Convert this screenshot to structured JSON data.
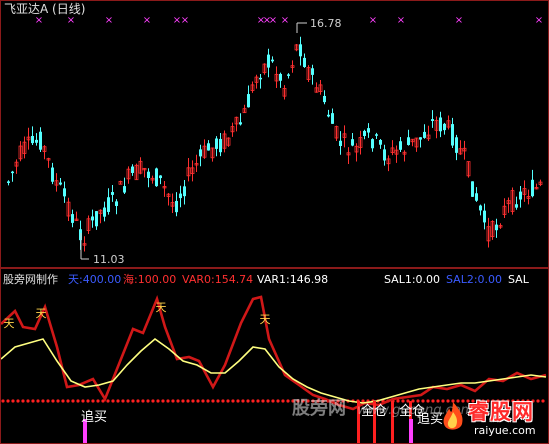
{
  "window": {
    "title": "飞亚达A (日线)"
  },
  "main_chart": {
    "high_label": "16.78",
    "low_label": "11.03"
  },
  "indicator": {
    "name": "股旁网制作",
    "values": [
      {
        "label": "天:400.00",
        "color": "#3b5bff"
      },
      {
        "label": "海:100.00",
        "color": "#ff3030"
      },
      {
        "label": "VAR0:154.74",
        "color": "#ff3030"
      },
      {
        "label": "VAR1:146.98",
        "color": "#ffffff"
      },
      {
        "label": "SAL1:0.00",
        "color": "#ffffff"
      },
      {
        "label": "SAL2:0.00",
        "color": "#3b5bff"
      },
      {
        "label": "SAL",
        "color": "#ffffff"
      }
    ],
    "signal_labels": [
      "追买",
      "全仓",
      "全仓",
      "追买"
    ],
    "star_glyph": "天"
  },
  "watermarks": {
    "site_cn": "股旁网",
    "site_en": "www.gupang.com",
    "logo_cn": "睿股网",
    "logo_en": "raiyue.com"
  },
  "colors": {
    "up": "#ff3030",
    "down": "#54ffff",
    "yellow": "#ffff80",
    "magenta": "#ff40ff",
    "grid": "#8b1a1a"
  }
}
